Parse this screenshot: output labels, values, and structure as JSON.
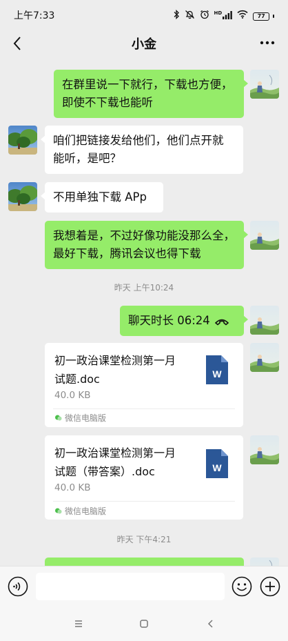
{
  "status_bar": {
    "time": "上午7:33",
    "hd_label": "HD",
    "battery_level": "77"
  },
  "header": {
    "title": "小金",
    "back_glyph": "‹",
    "more_glyph": "···"
  },
  "messages": [
    {
      "sender": "me",
      "lines": [
        "在群里说一下就行，下载也方便，",
        "即使不下载也能听"
      ]
    },
    {
      "sender": "other",
      "lines": [
        "咱们把链接发给他们，他们点开就",
        "能听，是吧？"
      ]
    },
    {
      "sender": "other",
      "lines": [
        "不用单独下载 APp"
      ]
    },
    {
      "sender": "me",
      "lines": [
        "我想着是，不过好像功能没那么全，",
        "最好下载，腾讯会议也得下载"
      ]
    }
  ],
  "timestamp_1": "昨天 上午10:24",
  "call_record": {
    "text": "聊天时长 06:24"
  },
  "files": [
    {
      "name_lines": [
        "初一政治课堂检测第一月",
        "试题.doc"
      ],
      "size": "40.0 KB",
      "source": "微信电脑版",
      "icon_letter": "W"
    },
    {
      "name_lines": [
        "初一政治课堂检测第一月",
        "试题（带答案）.doc"
      ],
      "size": "40.0 KB",
      "source": "微信电脑版",
      "icon_letter": "W"
    }
  ],
  "timestamp_2": "昨天 下午4:21",
  "input": {
    "placeholder": ""
  },
  "colors": {
    "my_bubble": "#95ec69",
    "other_bubble": "#ffffff",
    "background": "#ededed",
    "word_blue": "#2b5797"
  }
}
